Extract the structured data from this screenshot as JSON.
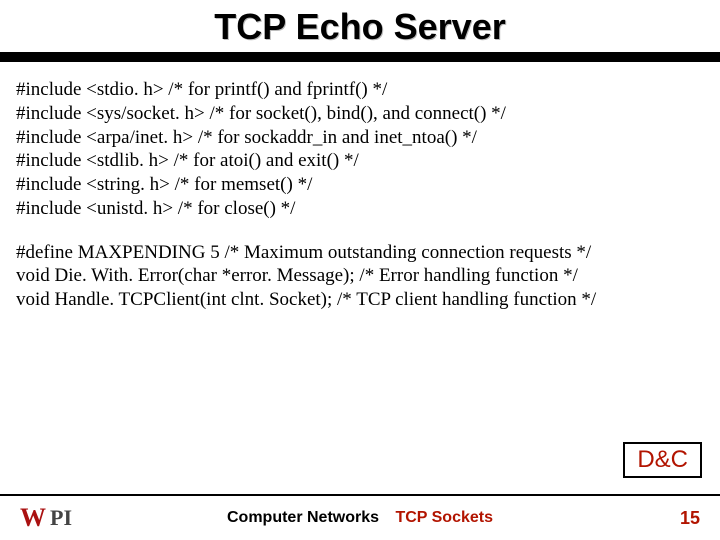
{
  "title": "TCP Echo Server",
  "code1": [
    "#include <stdio. h>          /* for printf() and fprintf() */",
    "#include <sys/socket. h> /* for socket(), bind(), and connect() */",
    "#include <arpa/inet. h>   /* for sockaddr_in and inet_ntoa() */",
    "#include <stdlib. h>         /* for atoi() and exit() */",
    "#include <string. h>         /* for memset() */",
    "#include <unistd. h>        /* for close() */"
  ],
  "code2": [
    "#define MAXPENDING 5           /* Maximum outstanding connection requests */",
    "void Die. With. Error(char *error. Message);     /* Error handling function */",
    "void Handle. TCPClient(int clnt. Socket);       /* TCP client handling function */"
  ],
  "dc_label": "D&C",
  "footer": {
    "center_black": "Computer Networks",
    "center_red": "TCP Sockets",
    "page": "15",
    "logo_w": "W",
    "logo_pi": "PI"
  }
}
